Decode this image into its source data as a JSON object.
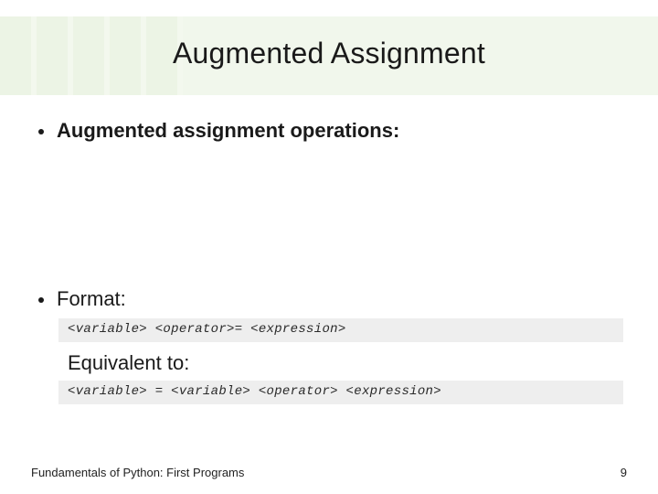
{
  "title": "Augmented Assignment",
  "bullet1": "Augmented assignment operations:",
  "bullet2": "Format:",
  "code1": "<variable> <operator>= <expression>",
  "equivalent_label": "Equivalent to:",
  "code2": "<variable> = <variable> <operator> <expression>",
  "footer_left": "Fundamentals of Python: First Programs",
  "footer_right": "9"
}
